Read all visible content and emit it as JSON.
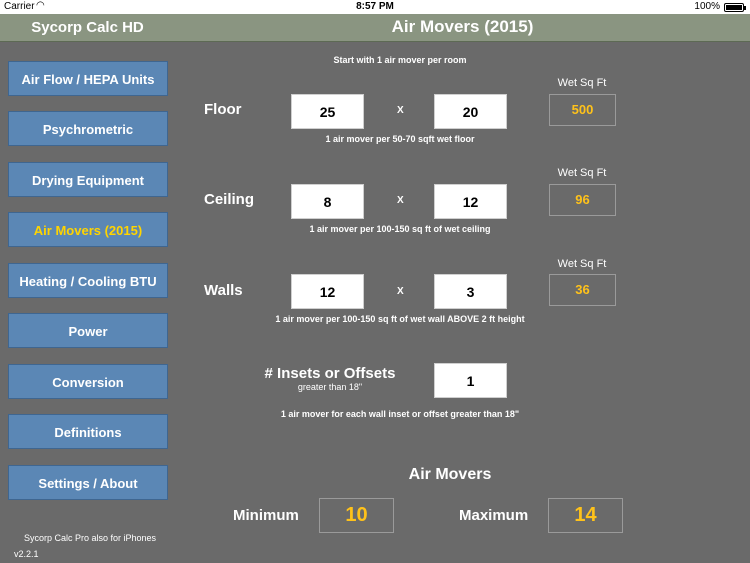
{
  "status_bar": {
    "carrier": "Carrier",
    "wifi_icon": "wifi-icon",
    "time": "8:57 PM",
    "battery": "100%",
    "battery_fill_fraction": 1.0
  },
  "header": {
    "app_title": "Sycorp Calc HD",
    "page_title": "Air Movers (2015)"
  },
  "sidebar": {
    "items": [
      {
        "label": "Air Flow / HEPA Units",
        "active": false
      },
      {
        "label": "Psychrometric",
        "active": false
      },
      {
        "label": "Drying Equipment",
        "active": false
      },
      {
        "label": "Air Movers (2015)",
        "active": true
      },
      {
        "label": "Heating / Cooling BTU",
        "active": false
      },
      {
        "label": "Power",
        "active": false
      },
      {
        "label": "Conversion",
        "active": false
      },
      {
        "label": "Definitions",
        "active": false
      },
      {
        "label": "Settings / About",
        "active": false
      }
    ],
    "promo": "Sycorp Calc Pro also for iPhones",
    "version": "v2.2.1"
  },
  "main": {
    "intro": "Start with 1 air mover per room",
    "floor": {
      "label": "Floor",
      "a": "25",
      "b": "20",
      "x": "X",
      "result_label": "Wet Sq Ft",
      "result": "500",
      "note": "1 air mover per 50-70 sqft wet floor"
    },
    "ceiling": {
      "label": "Ceiling",
      "a": "8",
      "b": "12",
      "x": "X",
      "result_label": "Wet Sq Ft",
      "result": "96",
      "note": "1 air mover per 100-150 sq ft of wet ceiling"
    },
    "walls": {
      "label": "Walls",
      "a": "12",
      "b": "3",
      "x": "X",
      "result_label": "Wet Sq Ft",
      "result": "36",
      "note": "1 air mover per 100-150 sq ft of wet wall ABOVE 2 ft height"
    },
    "insets": {
      "label": "# Insets or Offsets",
      "sublabel": "greater than 18\"",
      "value": "1",
      "note": "1 air mover for each wall inset or offset greater than 18\""
    },
    "air_movers": {
      "title": "Air Movers",
      "min_label": "Minimum",
      "min_value": "10",
      "max_label": "Maximum",
      "max_value": "14"
    }
  },
  "colors": {
    "background": "#6a6a6a",
    "header": "#8a9581",
    "nav_button": "#5b87b5",
    "active_text": "#ffd400",
    "result_text": "#ffc21a"
  }
}
